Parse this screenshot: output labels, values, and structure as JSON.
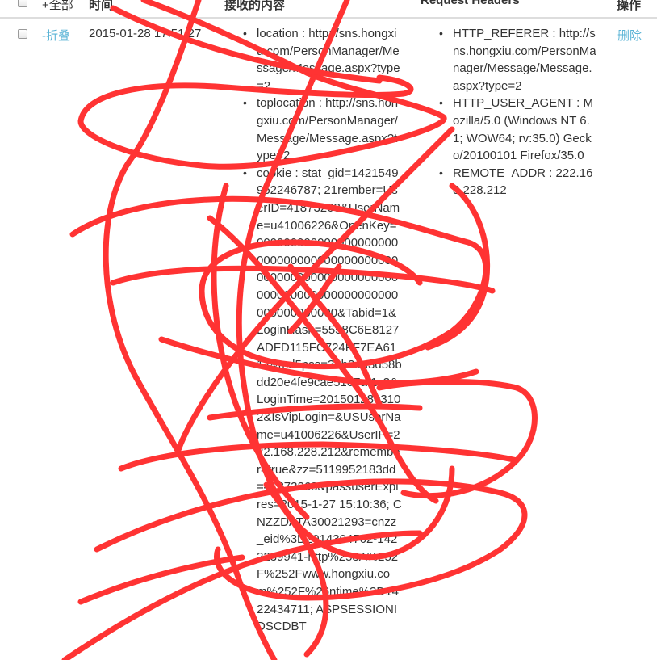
{
  "header": {
    "select_all_label": "+全部",
    "col_time": "时间",
    "col_content": "接收的内容",
    "col_request_headers": "Request Headers",
    "col_action": "操作"
  },
  "row": {
    "collapse_label": "-折叠",
    "time": "2015-01-28 17:51:27",
    "content_items": [
      {
        "key": "location",
        "value": "http://sns.hongxiu.com/PersonManager/Message/Message.aspx?type=2"
      },
      {
        "key": "toplocation",
        "value": "http://sns.hongxiu.com/PersonManager/Message/Message.aspx?type=2"
      },
      {
        "key": "cookie",
        "value": "stat_gid=1421549962246787; 21rember=UserID=41873263&UserName=u41006226&OpenKey=000000000000000000000000000000000000000000000000000000000000000000000000000000000000000000000000&Tabid=1&LoginHash=5558C6E8127ADFD115FC724FF7EA6112&md5pss=3eb2aa3d58bdd20e4fe9cae5107af1c3&LoginTime=2015012803102&IsVipLogin=&USUserName=u41006226&UserIP=222.168.228.212&remember=true&zz=5119952183dd=41873263&passuserExpires=2015-1-27 15:10:36; CNZZDATA30021293=cnzz_eid%3D2014304762-1422239941-http%253A%252F%252Fwww.hongxiu.com%252F%26ntime%3D1422434711; ASPSESSIONIDSCDBT"
      }
    ],
    "header_items": [
      {
        "key": "HTTP_REFERER",
        "value": "http://sns.hongxiu.com/PersonManager/Message/Message.aspx?type=2"
      },
      {
        "key": "HTTP_USER_AGENT",
        "value": "Mozilla/5.0 (Windows NT 6.1; WOW64; rv:35.0) Gecko/20100101 Firefox/35.0"
      },
      {
        "key": "REMOTE_ADDR",
        "value": "222.168.228.212"
      }
    ],
    "delete_label": "删除"
  },
  "colors": {
    "link": "#5bb4d6",
    "scribble": "#ff3333",
    "divider": "#dddddd"
  }
}
